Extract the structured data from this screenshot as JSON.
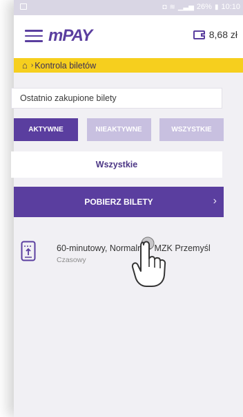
{
  "status_bar": {
    "battery": "26%",
    "time": "10:10"
  },
  "app_bar": {
    "logo": "mPAY",
    "balance": "8,68 zł"
  },
  "breadcrumb": {
    "home_icon": "home-icon",
    "separator": "›",
    "label": "Kontrola biletów"
  },
  "recent": {
    "label": "Ostatnio zakupione bilety"
  },
  "tabs": [
    {
      "label": "AKTYWNE",
      "active": true
    },
    {
      "label": "NIEAKTYWNE",
      "active": false
    },
    {
      "label": "WSZYSTKIE",
      "active": false
    }
  ],
  "filter": {
    "label": "Wszystkie"
  },
  "download": {
    "label": "POBIERZ BILETY",
    "chevron": "›"
  },
  "ticket": {
    "title": "60-minutowy, Normalny - MZK Przemyśl",
    "subtitle": "Czasowy"
  },
  "colors": {
    "accent": "#5a3e9f",
    "banner": "#f6cf1e",
    "tab_inactive": "#c8c0e0"
  }
}
